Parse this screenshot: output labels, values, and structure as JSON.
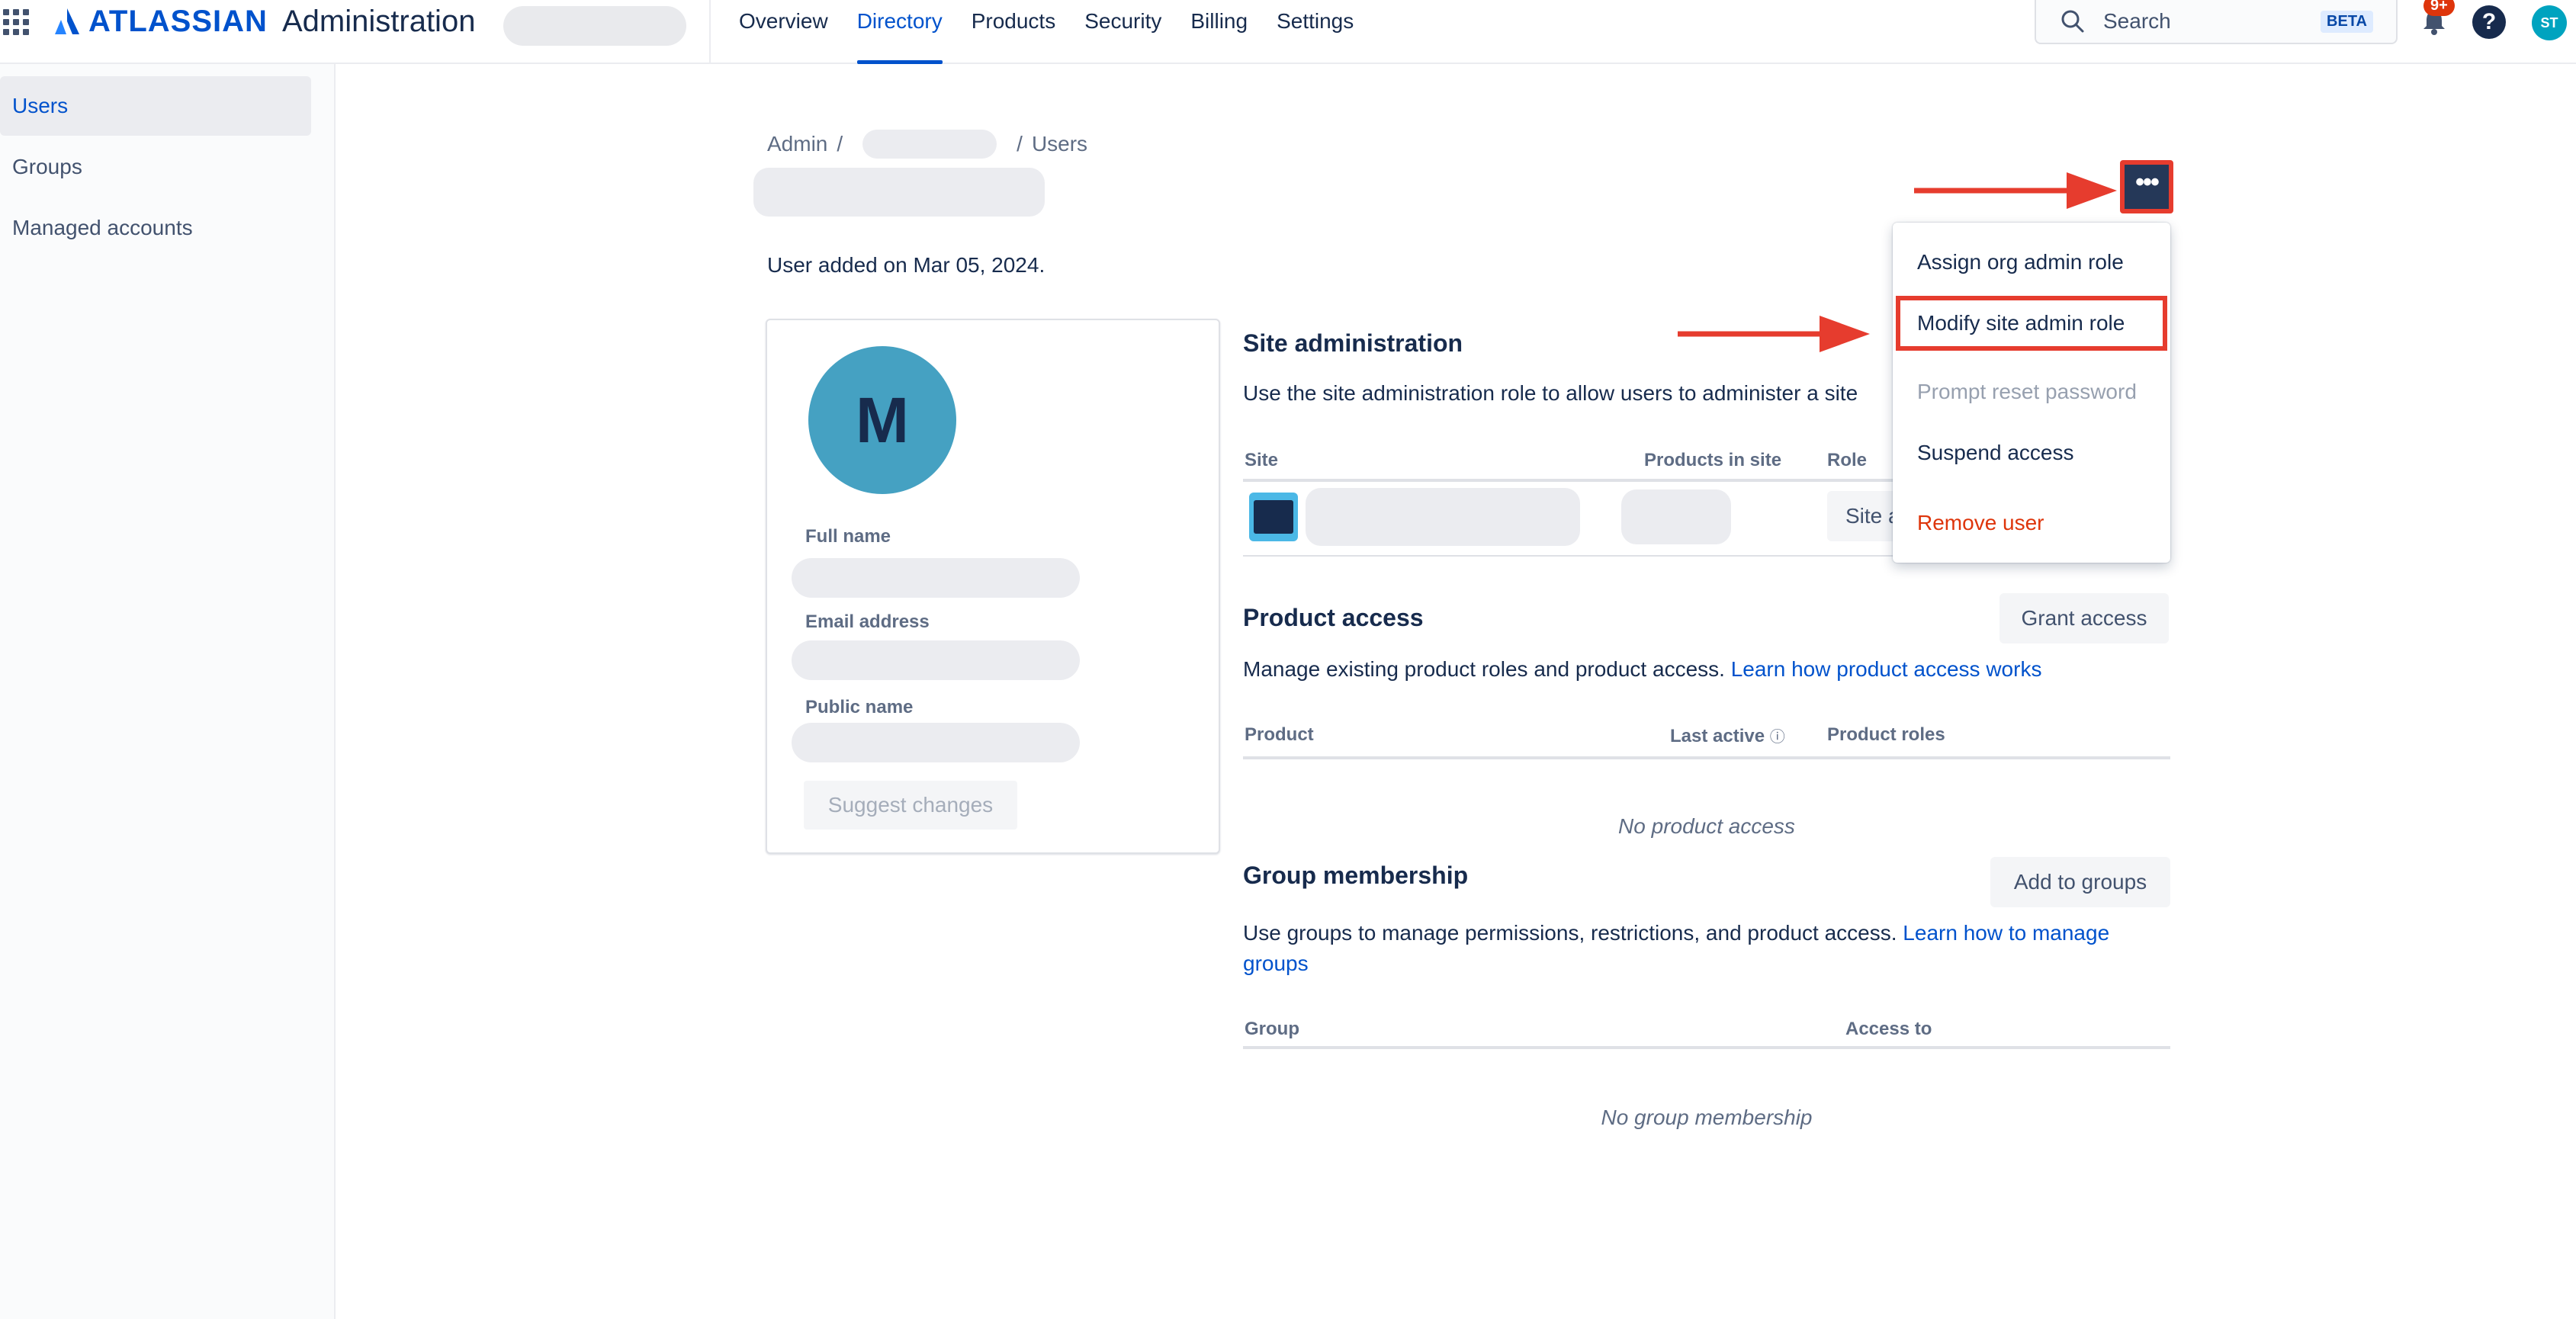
{
  "topbar": {
    "brand": "ATLASSIAN",
    "product": "Administration",
    "nav": [
      "Overview",
      "Directory",
      "Products",
      "Security",
      "Billing",
      "Settings"
    ],
    "active_nav": "Directory",
    "search_placeholder": "Search",
    "search_badge": "BETA",
    "notifications_count": "9+",
    "help_glyph": "?",
    "user_initials": "ST"
  },
  "sidebar": {
    "items": [
      "Users",
      "Groups",
      "Managed accounts"
    ],
    "active": "Users"
  },
  "main": {
    "breadcrumb": {
      "root": "Admin",
      "sep": "/",
      "leaf": "Users"
    },
    "user_added": "User added on Mar 05, 2024.",
    "more_button": "•••",
    "profile": {
      "avatar_initial": "M",
      "full_name_label": "Full name",
      "email_label": "Email address",
      "public_name_label": "Public name",
      "suggest_button": "Suggest changes"
    },
    "site_admin": {
      "title": "Site administration",
      "description": "Use the site administration role to allow users to administer a site",
      "columns": {
        "site": "Site",
        "products": "Products in site",
        "role": "Role"
      },
      "role_value": "Site a"
    },
    "product_access": {
      "title": "Product access",
      "description": "Manage existing product roles and product access.",
      "link": "Learn how product access works",
      "button": "Grant access",
      "columns": {
        "product": "Product",
        "last_active": "Last active",
        "roles": "Product roles"
      },
      "info_glyph": "ⓘ",
      "empty": "No product access"
    },
    "group_membership": {
      "title": "Group membership",
      "description": "Use groups to manage permissions, restrictions, and product access.",
      "link_part1": "Learn how to manage",
      "link_part2": "groups",
      "button": "Add to groups",
      "columns": {
        "group": "Group",
        "access": "Access to"
      },
      "empty": "No group membership"
    }
  },
  "menu": {
    "items": [
      "Assign org admin role",
      "Modify site admin role",
      "Prompt reset password",
      "Suspend access",
      "Remove user"
    ]
  },
  "colors": {
    "brand_blue": "#0052cc",
    "annotation_red": "#e63c2e",
    "danger": "#de350b",
    "avatar": "#45a1c2"
  }
}
